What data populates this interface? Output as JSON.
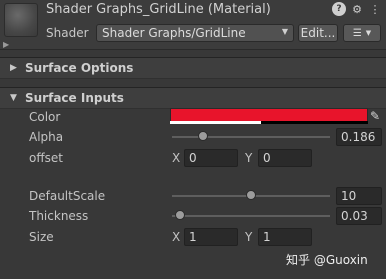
{
  "header": {
    "title": "Shader Graphs_GridLine (Material)",
    "shader_label": "Shader",
    "shader_value": "Shader Graphs/GridLine",
    "edit_button": "Edit...",
    "list_icon": "list-icon",
    "help_icon": "help-icon",
    "settings_icon": "settings-icon",
    "menu_icon": "kebab-menu-icon"
  },
  "sections": {
    "surface_options": "Surface Options",
    "surface_inputs": "Surface Inputs"
  },
  "properties": {
    "color": {
      "label": "Color",
      "value": "#e8142b",
      "alpha_fraction": 0.46
    },
    "alpha": {
      "label": "Alpha",
      "value": "0.186",
      "slider_fraction": 0.186
    },
    "offset": {
      "label": "offset",
      "x_label": "X",
      "x": "0",
      "y_label": "Y",
      "y": "0"
    },
    "default_scale": {
      "label": "DefaultScale",
      "value": "10",
      "slider_fraction": 0.5
    },
    "thickness": {
      "label": "Thickness",
      "value": "0.03",
      "slider_fraction": 0.03
    },
    "size": {
      "label": "Size",
      "x_label": "X",
      "x": "1",
      "y_label": "Y",
      "y": "1"
    }
  },
  "watermark": "知乎 @Guoxin"
}
